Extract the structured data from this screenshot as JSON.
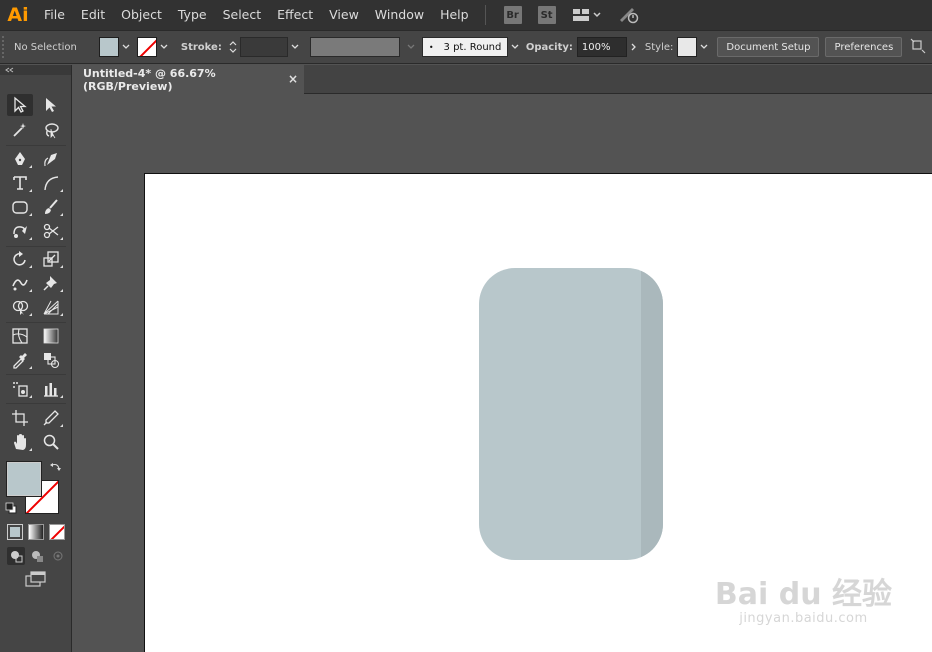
{
  "app": {
    "logo": "Ai"
  },
  "menu": [
    "File",
    "Edit",
    "Object",
    "Type",
    "Select",
    "Effect",
    "View",
    "Window",
    "Help"
  ],
  "menu_badges": {
    "bridge": "Br",
    "stock": "St"
  },
  "control": {
    "selection": "No Selection",
    "stroke_label": "Stroke:",
    "brush": "3 pt. Round",
    "opacity_label": "Opacity:",
    "opacity_value": "100%",
    "style_label": "Style:",
    "document_setup": "Document Setup",
    "preferences": "Preferences"
  },
  "document": {
    "tab_title": "Untitled-4* @ 66.67% (RGB/Preview)",
    "close": "×"
  },
  "colors": {
    "fill": "#b8c7cb",
    "shape_shade": "#aab8bc",
    "stroke": "none"
  },
  "watermark": {
    "main": "Bai du 经验",
    "sub": "jingyan.baidu.com"
  }
}
